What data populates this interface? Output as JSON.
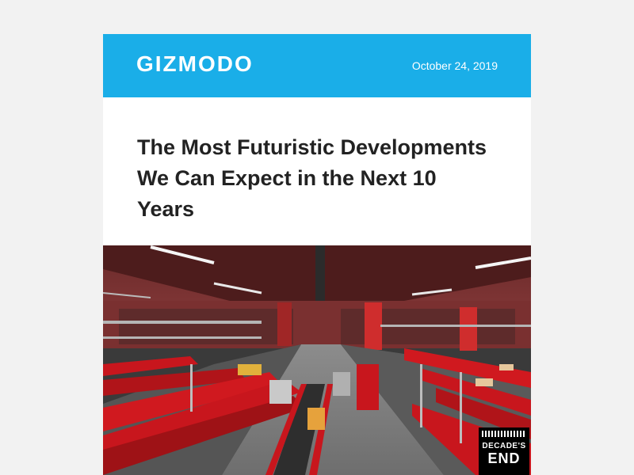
{
  "header": {
    "logo_text": "GIZMODO",
    "date": "October 24, 2019",
    "background_color": "#1aaee8"
  },
  "article": {
    "headline": "The Most Futuristic Developments We Can Expect in the Next 10 Years"
  },
  "hero_image": {
    "description_icon": "warehouse-photo",
    "badge_line1": "DECADE'S",
    "badge_line2": "END"
  },
  "colors": {
    "page_background": "#f2f2f2",
    "headline_text": "#222222",
    "conveyor_red": "#c8161d"
  }
}
